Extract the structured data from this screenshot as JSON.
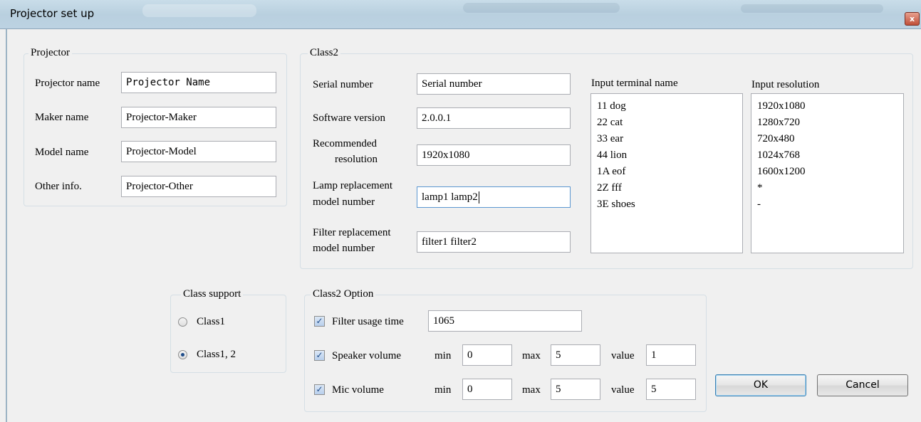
{
  "window": {
    "title": "Projector set up",
    "close_glyph": "x"
  },
  "projector": {
    "legend": "Projector",
    "fields": [
      {
        "label": "Projector name",
        "value": "Projector Name"
      },
      {
        "label": "Maker name",
        "value": "Projector-Maker"
      },
      {
        "label": "Model name",
        "value": "Projector-Model"
      },
      {
        "label": "Other info.",
        "value": "Projector-Other"
      }
    ]
  },
  "class2": {
    "legend": "Class2",
    "serial_label": "Serial number",
    "serial_value": "Serial number",
    "software_label": "Software version",
    "software_value": "2.0.0.1",
    "recommended_label_1": "Recommended",
    "recommended_label_2": "resolution",
    "recommended_value": "1920x1080",
    "lamp_label_1": "Lamp replacement",
    "lamp_label_2": "model number",
    "lamp_value": "lamp1 lamp2",
    "filter_label_1": "Filter replacement",
    "filter_label_2": "model number",
    "filter_value": "filter1 filter2",
    "input_terminal_header": "Input terminal name",
    "input_terminals": [
      "11 dog",
      "22 cat",
      "33 ear",
      "44 lion",
      "1A eof",
      "2Z fff",
      "3E shoes"
    ],
    "input_resolution_header": "Input resolution",
    "input_resolutions": [
      "1920x1080",
      "1280x720",
      "720x480",
      "1024x768",
      "1600x1200",
      "*",
      "-"
    ]
  },
  "class_support": {
    "legend": "Class support",
    "options": [
      {
        "label": "Class1",
        "selected": false
      },
      {
        "label": "Class1, 2",
        "selected": true
      }
    ]
  },
  "class2_option": {
    "legend": "Class2 Option",
    "filter_label": "Filter usage time",
    "filter_checked": true,
    "filter_value": "1065",
    "min_label": "min",
    "max_label": "max",
    "value_label": "value",
    "speaker": {
      "label": "Speaker volume",
      "checked": true,
      "min": "0",
      "max": "5",
      "value": "1"
    },
    "mic": {
      "label": "Mic volume",
      "checked": true,
      "min": "0",
      "max": "5",
      "value": "5"
    }
  },
  "buttons": {
    "ok": "OK",
    "cancel": "Cancel"
  },
  "colors": {
    "accent": "#1f4d8a",
    "focus_border": "#5b97d1",
    "close_red": "#c0503a"
  }
}
